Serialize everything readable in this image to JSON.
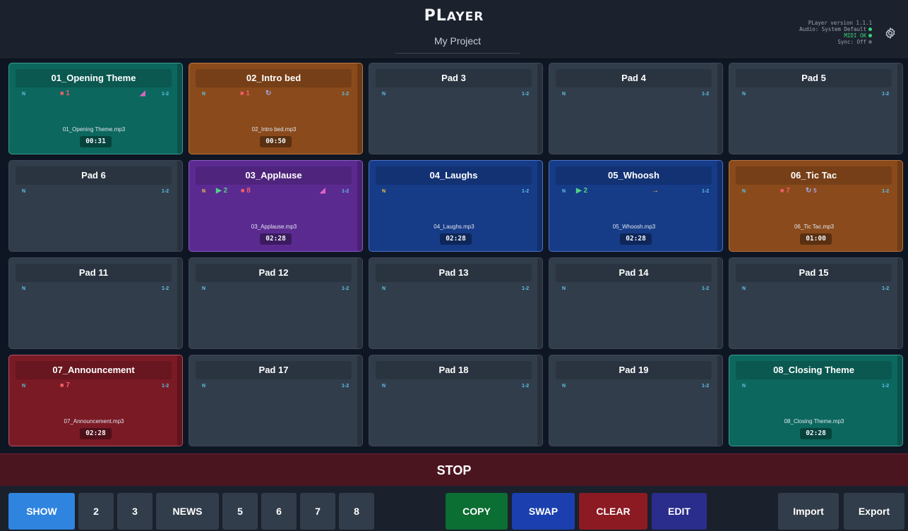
{
  "app": {
    "logo_big": "PL",
    "logo_small": "AYER",
    "project": "My Project"
  },
  "status": {
    "version": "PLayer version 1.1.1",
    "audio": "Audio: System Default",
    "midi": "MIDI OK",
    "sync": "Sync: Off"
  },
  "pads": [
    {
      "title": "01_Opening Theme",
      "n": "N",
      "ch": "1-2",
      "color": "teal",
      "stop": "1",
      "pink": true,
      "file": "01_Opening Theme.mp3",
      "time": "00:31"
    },
    {
      "title": "02_Intro bed",
      "n": "N",
      "ch": "1-2",
      "color": "orange",
      "stop": "1",
      "loop": "",
      "file": "02_Intro bed.mp3",
      "time": "00:50"
    },
    {
      "title": "Pad 3",
      "n": "N",
      "ch": "1-2"
    },
    {
      "title": "Pad 4",
      "n": "N",
      "ch": "1-2"
    },
    {
      "title": "Pad 5",
      "n": "N",
      "ch": "1-2"
    },
    {
      "title": "Pad 6",
      "n": "N",
      "ch": "1-2"
    },
    {
      "title": "03_Applause",
      "n": "N",
      "n_yellow": true,
      "ch": "1-2",
      "color": "purple",
      "play": "2",
      "stop": "8",
      "pink": true,
      "file": "03_Applause.mp3",
      "time": "02:28"
    },
    {
      "title": "04_Laughs",
      "n": "N",
      "n_yellow": true,
      "ch": "1-2",
      "color": "blue",
      "file": "04_Laughs.mp3",
      "time": "02:28"
    },
    {
      "title": "05_Whoosh",
      "n": "N",
      "ch": "1-2",
      "color": "blue",
      "play": "2",
      "arrow": true,
      "file": "05_Whoosh.mp3",
      "time": "02:28"
    },
    {
      "title": "06_Tic Tac",
      "n": "N",
      "ch": "1-2",
      "color": "orange",
      "stop": "7",
      "loop": "5",
      "file": "06_Tic Tac.mp3",
      "time": "01:00"
    },
    {
      "title": "Pad 11",
      "n": "N",
      "ch": "1-2"
    },
    {
      "title": "Pad 12",
      "n": "N",
      "ch": "1-2"
    },
    {
      "title": "Pad 13",
      "n": "N",
      "ch": "1-2"
    },
    {
      "title": "Pad 14",
      "n": "N",
      "ch": "1-2"
    },
    {
      "title": "Pad 15",
      "n": "N",
      "ch": "1-2"
    },
    {
      "title": "07_Announcement",
      "n": "N",
      "ch": "1-2",
      "color": "red",
      "stop": "7",
      "file": "07_Announcement.mp3",
      "time": "02:28"
    },
    {
      "title": "Pad 17",
      "n": "N",
      "ch": "1-2"
    },
    {
      "title": "Pad 18",
      "n": "N",
      "ch": "1-2"
    },
    {
      "title": "Pad 19",
      "n": "N",
      "ch": "1-2"
    },
    {
      "title": "08_Closing Theme",
      "n": "N",
      "ch": "1-2",
      "color": "teal",
      "file": "08_Closing Theme.mp3",
      "time": "02:28"
    }
  ],
  "stop_label": "STOP",
  "banks": [
    {
      "label": "SHOW",
      "active": true
    },
    {
      "label": "2"
    },
    {
      "label": "3"
    },
    {
      "label": "NEWS"
    },
    {
      "label": "5"
    },
    {
      "label": "6"
    },
    {
      "label": "7"
    },
    {
      "label": "8"
    }
  ],
  "actions": {
    "copy": "COPY",
    "swap": "SWAP",
    "clear": "CLEAR",
    "edit": "EDIT"
  },
  "io": {
    "import": "Import",
    "export": "Export"
  },
  "colors": {
    "teal": "#0c675e",
    "orange": "#8a4a1b",
    "purple": "#5b2a91",
    "blue": "#163b87",
    "red": "#7a1a25",
    "active_tab": "#2f84e0",
    "stop_bar": "#4b1520"
  }
}
